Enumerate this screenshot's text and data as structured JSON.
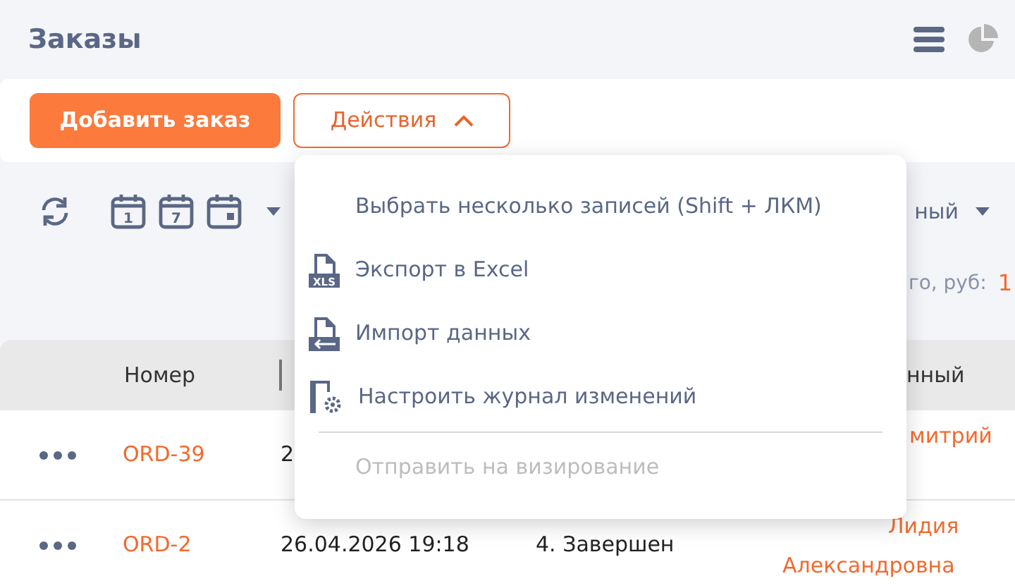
{
  "title": "Заказы",
  "toolbar": {
    "add_button": "Добавить заказ",
    "actions_button": "Действия",
    "actions_expanded": true
  },
  "calendar_buttons": [
    {
      "kind": "day",
      "label": "1"
    },
    {
      "kind": "week",
      "label": "7"
    },
    {
      "kind": "custom"
    }
  ],
  "view_selector": {
    "value_fragment": "ный"
  },
  "summary": {
    "label_fragment": "го, руб:",
    "value_fragment": "1"
  },
  "table": {
    "columns": [
      "Номер",
      "нный"
    ],
    "rows": [
      {
        "number": "ORD-39",
        "date": "2",
        "responsible": "митрий"
      },
      {
        "number": "ORD-2",
        "date": "26.04.2026 19:18",
        "status": "4. Завершен",
        "responsible": "Лидия Александровна"
      }
    ]
  },
  "actions_menu": [
    {
      "kind": "plain",
      "label": "Выбрать несколько записей (Shift + ЛКМ)",
      "disabled": false
    },
    {
      "kind": "export",
      "label": "Экспорт в Excel",
      "badge": "XLS",
      "disabled": false
    },
    {
      "kind": "import",
      "label": "Импорт данных",
      "disabled": false
    },
    {
      "kind": "journal",
      "label": "Настроить журнал изменений",
      "disabled": false
    },
    {
      "kind": "divider"
    },
    {
      "kind": "plain",
      "label": "Отправить на визирование",
      "disabled": true
    }
  ]
}
